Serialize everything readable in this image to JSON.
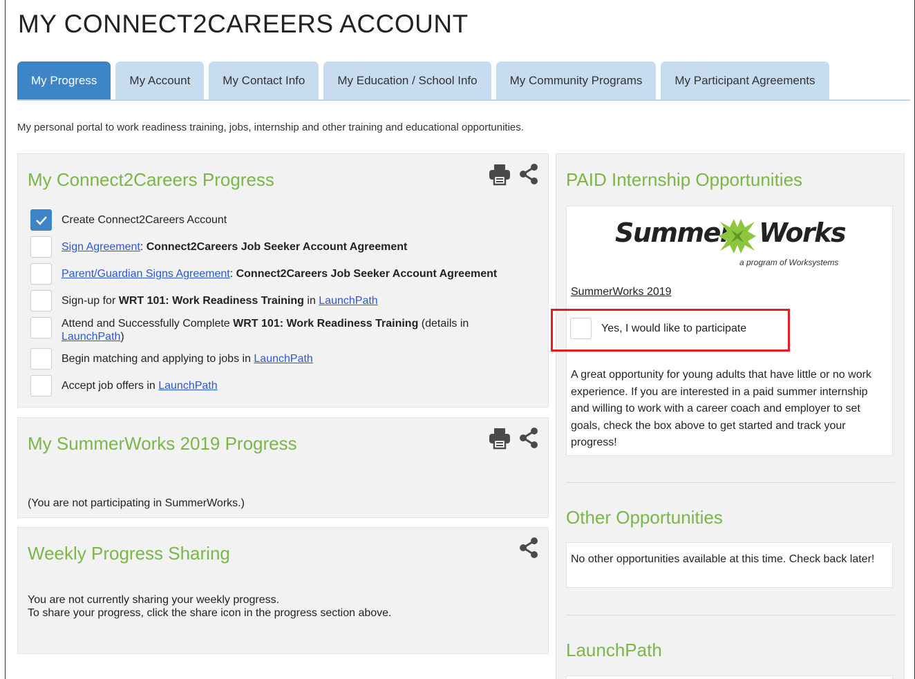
{
  "page": {
    "title": "MY CONNECT2CAREERS ACCOUNT",
    "intro": "My personal portal to work readiness training, jobs, internship and other training and educational opportunities."
  },
  "tabs": [
    {
      "label": "My Progress",
      "active": true
    },
    {
      "label": "My Account",
      "active": false
    },
    {
      "label": "My Contact Info",
      "active": false
    },
    {
      "label": "My Education / School Info",
      "active": false
    },
    {
      "label": "My Community Programs",
      "active": false
    },
    {
      "label": "My Participant Agreements",
      "active": false
    }
  ],
  "progress": {
    "title": "My Connect2Careers Progress",
    "items": {
      "create": {
        "text": "Create Connect2Careers Account",
        "checked": true
      },
      "sign": {
        "link": "Sign Agreement",
        "sep": ": ",
        "bold": "Connect2Careers Job Seeker Account Agreement",
        "checked": false
      },
      "parent": {
        "link": "Parent/Guardian Signs Agreement",
        "sep": ": ",
        "bold": "Connect2Careers Job Seeker Account Agreement",
        "checked": false
      },
      "signup": {
        "pre": "Sign-up for ",
        "bold": "WRT 101: Work Readiness Training",
        "mid": " in ",
        "link": "LaunchPath",
        "checked": false
      },
      "attend": {
        "pre": "Attend and Successfully Complete ",
        "bold": "WRT 101: Work Readiness Training",
        "mid": " (details in ",
        "link": "LaunchPath",
        "post": ")",
        "checked": false
      },
      "match": {
        "pre": "Begin matching and applying to jobs in ",
        "link": "LaunchPath",
        "checked": false
      },
      "accept": {
        "pre": "Accept job offers in ",
        "link": "LaunchPath",
        "checked": false
      }
    }
  },
  "summerworks_progress": {
    "title": "My SummerWorks 2019 Progress",
    "status": "(You are not participating in SummerWorks.)"
  },
  "weekly": {
    "title": "Weekly Progress Sharing",
    "line1": "You are not currently sharing your weekly progress.",
    "line2": "To share your progress, click the share icon in the progress section above."
  },
  "paid": {
    "title": "PAID Internship Opportunities",
    "logo": {
      "word1": "Summer",
      "word2": "Works",
      "tagline": "a program of Worksystems"
    },
    "program_name": "SummerWorks 2019",
    "participate_label": "Yes, I would like to participate",
    "participate_checked": false,
    "description": "A great opportunity for young adults that have little or no work experience. If you are interested in a paid summer internship and willing to work with a career coach and employer to set goals, check the box above to get started and track your progress!"
  },
  "other": {
    "title": "Other Opportunities",
    "message": "No other opportunities available at this time. Check back later!"
  },
  "launchpath": {
    "title": "LaunchPath"
  },
  "colors": {
    "accent_blue": "#3d85c6",
    "tab_inactive": "#c8dcef",
    "heading_green": "#7ab648",
    "link_blue": "#2a57d6",
    "highlight_red": "#e41c23"
  },
  "icons": [
    "print-icon",
    "share-icon",
    "checkmark-icon",
    "summerworks-logo-mark"
  ]
}
